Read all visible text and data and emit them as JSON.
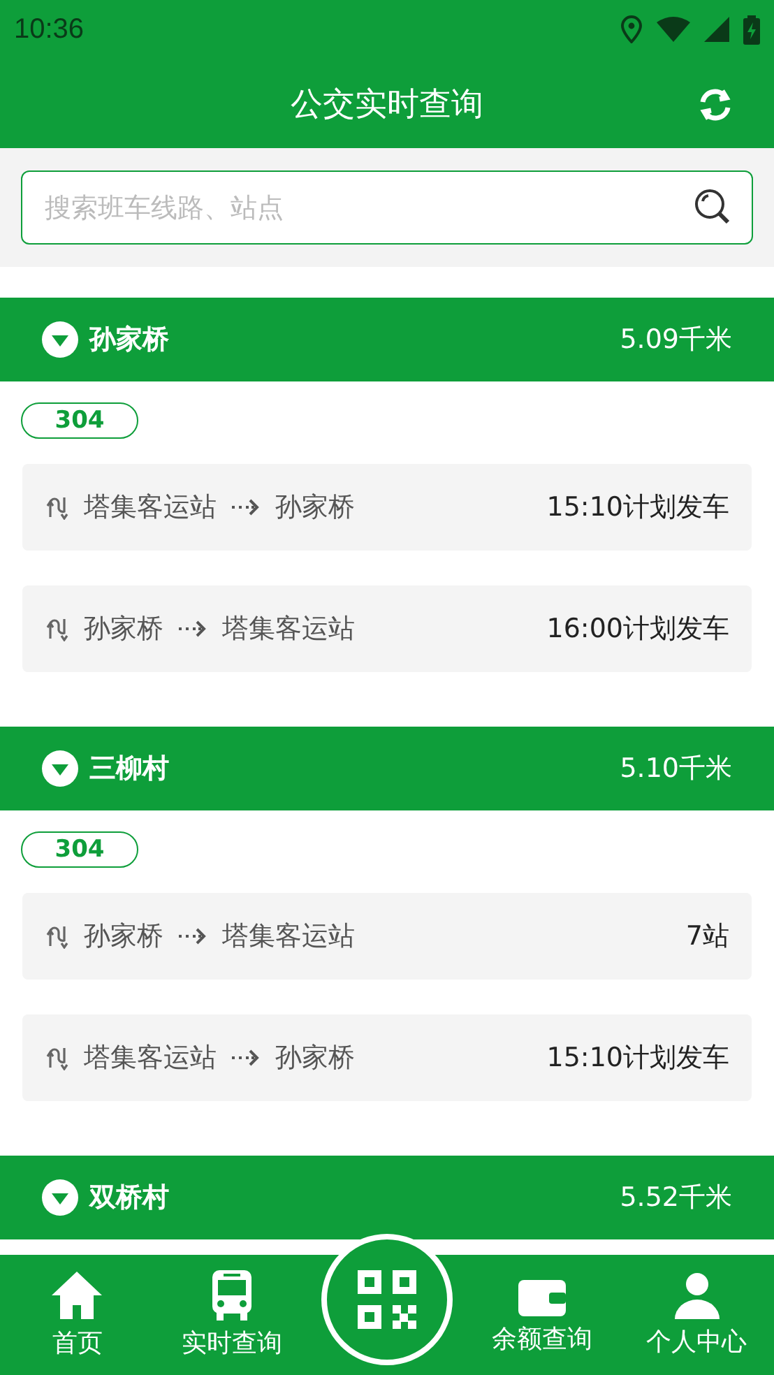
{
  "status_bar": {
    "time": "10:36"
  },
  "header": {
    "title": "公交实时查询"
  },
  "search": {
    "placeholder": "搜索班车线路、站点"
  },
  "stations": [
    {
      "name": "孙家桥",
      "distance": "5.09千米",
      "routes": [
        {
          "number": "304",
          "trips": [
            {
              "from": "塔集客运站",
              "to": "孙家桥",
              "info": "15:10计划发车"
            },
            {
              "from": "孙家桥",
              "to": "塔集客运站",
              "info": "16:00计划发车"
            }
          ]
        }
      ]
    },
    {
      "name": "三柳村",
      "distance": "5.10千米",
      "routes": [
        {
          "number": "304",
          "trips": [
            {
              "from": "孙家桥",
              "to": "塔集客运站",
              "info": "7站"
            },
            {
              "from": "塔集客运站",
              "to": "孙家桥",
              "info": "15:10计划发车"
            }
          ]
        }
      ]
    },
    {
      "name": "双桥村",
      "distance": "5.52千米"
    }
  ],
  "nav": [
    {
      "kind": "home",
      "label": "首页"
    },
    {
      "kind": "bus",
      "label": "实时查询"
    },
    {
      "kind": "qr"
    },
    {
      "kind": "wallet",
      "label": "余额查询"
    },
    {
      "kind": "user",
      "label": "个人中心"
    }
  ]
}
